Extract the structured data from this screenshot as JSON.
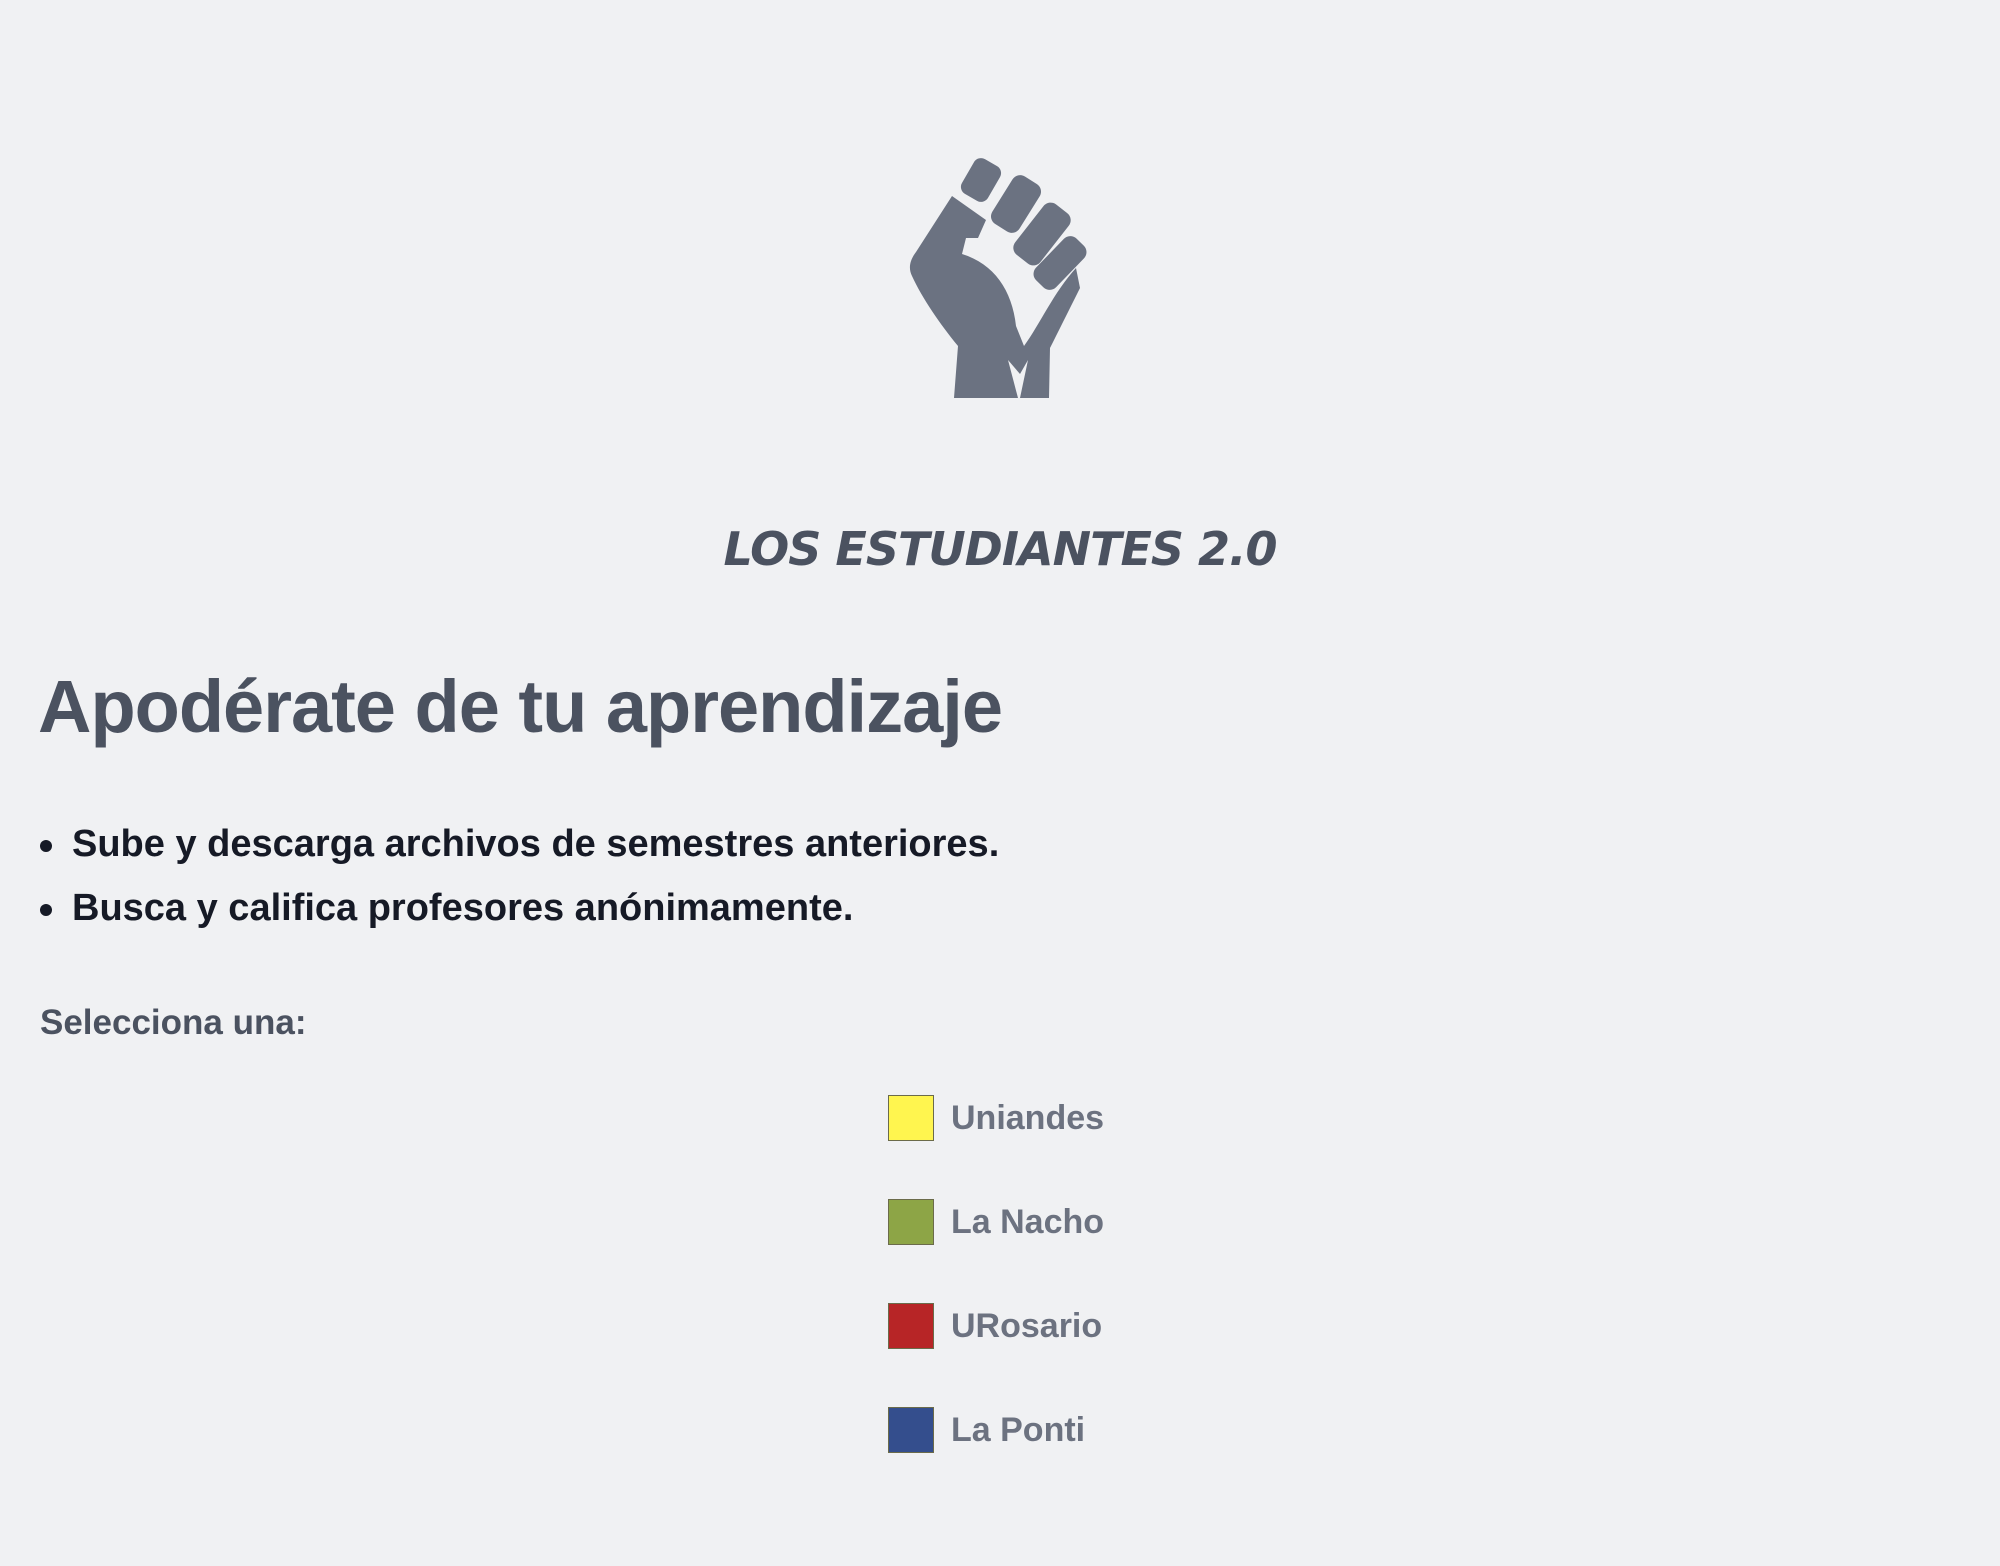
{
  "logo": {
    "icon": "raised-fist-icon",
    "color": "#6b7281"
  },
  "brand": {
    "title": "LOS ESTUDIANTES 2.0"
  },
  "hero": {
    "headline": "Apodérate de tu aprendizaje"
  },
  "features": [
    "Sube y descarga archivos de semestres anteriores.",
    "Busca y califica profesores anónimamente."
  ],
  "selection": {
    "prompt": "Selecciona una:",
    "options": [
      {
        "label": "Uniandes",
        "color": "#fff54f"
      },
      {
        "label": "La Nacho",
        "color": "#8da546"
      },
      {
        "label": "URosario",
        "color": "#b72526"
      },
      {
        "label": "La Ponti",
        "color": "#344e8d"
      }
    ]
  }
}
